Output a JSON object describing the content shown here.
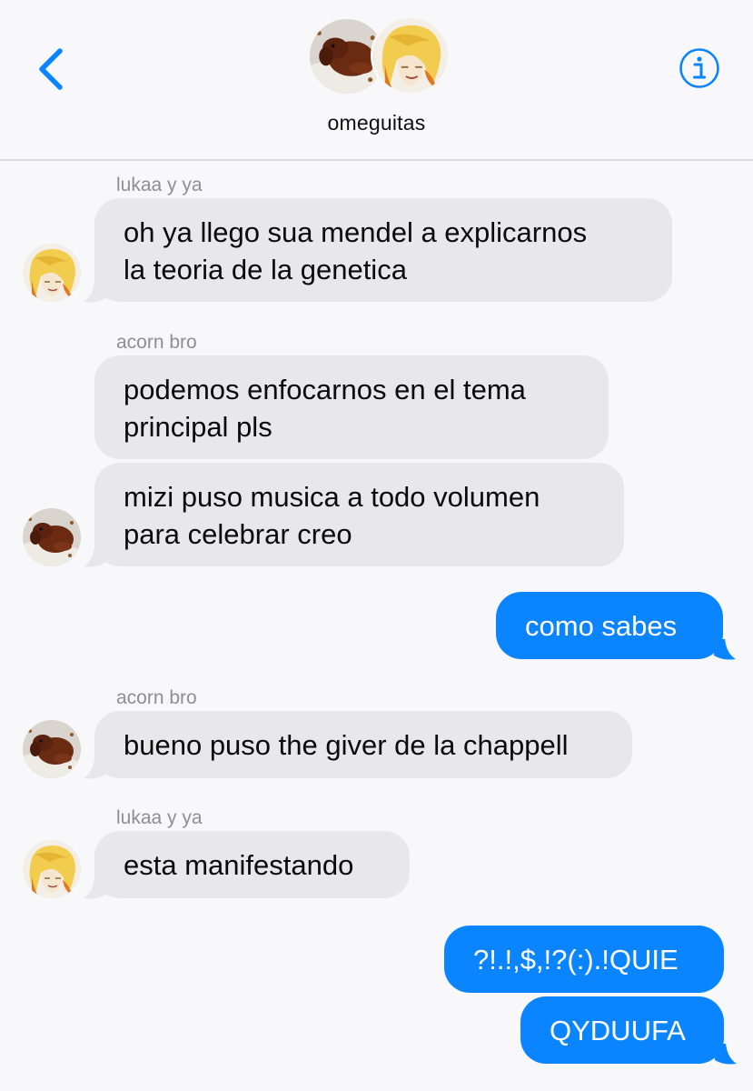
{
  "header": {
    "title": "omeguitas",
    "back_icon": "chevron-left-icon",
    "info_icon": "info-icon",
    "accent": "#0a84ff"
  },
  "messages": [
    {
      "sender": "lukaa y ya",
      "lines": [
        "oh ya llego sua mendel a explicarnos",
        "la teoria de la genetica"
      ],
      "direction": "incoming",
      "avatar": "anime-avatar"
    },
    {
      "sender": "acorn bro",
      "lines": [
        "podemos enfocarnos en el tema",
        "principal pls"
      ],
      "direction": "incoming"
    },
    {
      "lines": [
        "mizi puso musica a todo volumen",
        "para celebrar creo"
      ],
      "direction": "incoming",
      "avatar": "dog-avatar"
    },
    {
      "lines": [
        "como sabes"
      ],
      "direction": "outgoing"
    },
    {
      "sender": "acorn bro",
      "lines": [
        "bueno puso the giver de la chappell"
      ],
      "direction": "incoming",
      "avatar": "dog-avatar"
    },
    {
      "sender": "lukaa y ya",
      "lines": [
        "esta manifestando"
      ],
      "direction": "incoming",
      "avatar": "anime-avatar"
    },
    {
      "lines": [
        "?!.!,$,!?(:).!QUIE"
      ],
      "direction": "outgoing"
    },
    {
      "lines": [
        "QYDUUFA"
      ],
      "direction": "outgoing"
    }
  ],
  "colors": {
    "incoming_bubble": "#e8e7ec",
    "outgoing_bubble": "#0a84ff",
    "sender_label": "#8e8e93",
    "background": "#f8f8fa"
  }
}
